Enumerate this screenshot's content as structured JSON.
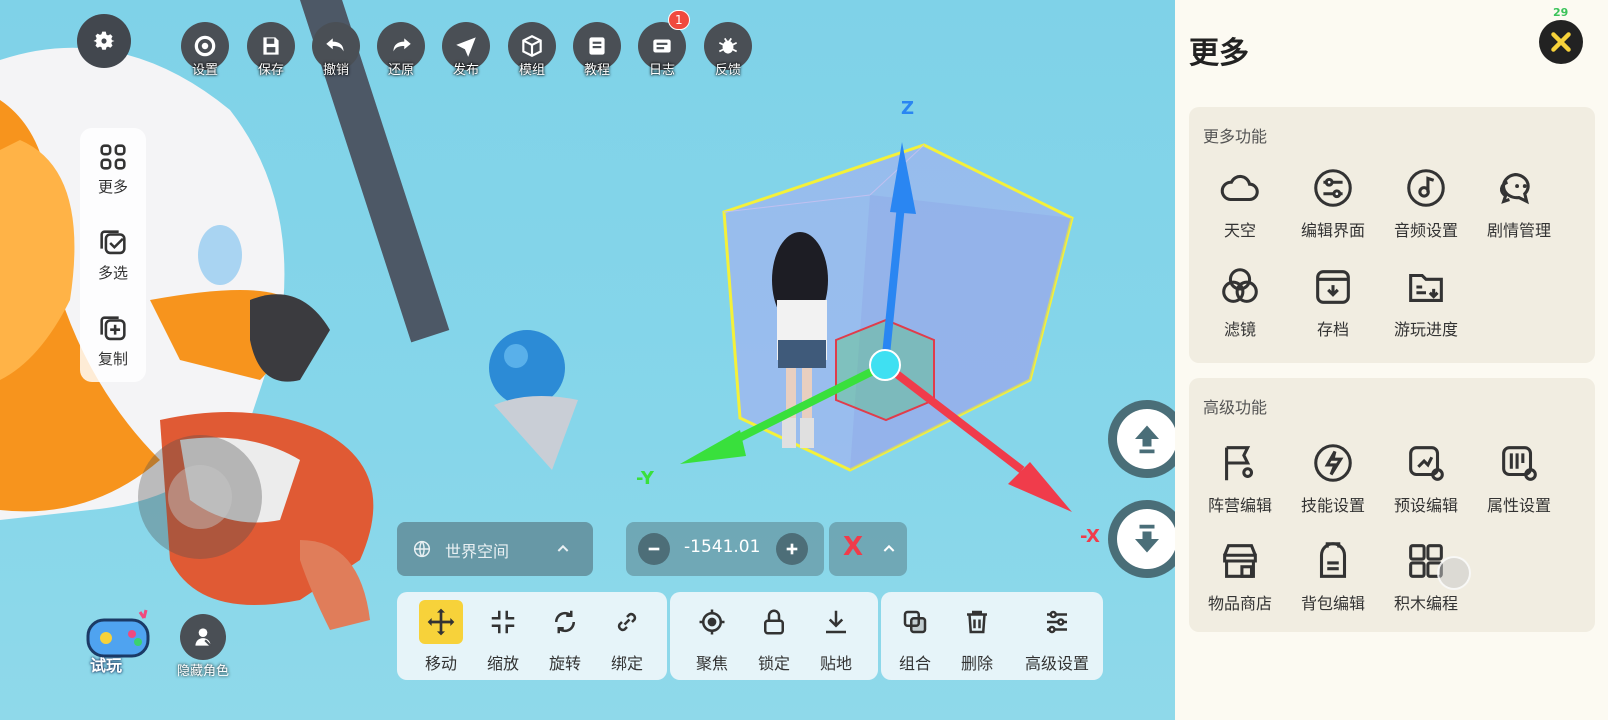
{
  "toolbar": {
    "items": [
      {
        "label": "设置",
        "icon": "gear-icon"
      },
      {
        "label": "保存",
        "icon": "save-icon"
      },
      {
        "label": "撤销",
        "icon": "undo-icon"
      },
      {
        "label": "还原",
        "icon": "redo-icon"
      },
      {
        "label": "发布",
        "icon": "send-icon"
      },
      {
        "label": "模组",
        "icon": "cube-icon"
      },
      {
        "label": "教程",
        "icon": "book-icon"
      },
      {
        "label": "日志",
        "icon": "log-icon"
      },
      {
        "label": "反馈",
        "icon": "bug-icon"
      }
    ],
    "log_badge": "1"
  },
  "left_panel": {
    "items": [
      {
        "label": "更多",
        "icon": "grid-icon"
      },
      {
        "label": "多选",
        "icon": "multi-select-icon"
      },
      {
        "label": "复制",
        "icon": "copy-icon"
      }
    ]
  },
  "viewport": {
    "axis_z": "Z",
    "axis_neg_y": "-Y",
    "axis_neg_x": "-X"
  },
  "space_selector": {
    "label": "世界空间"
  },
  "stepper": {
    "value": "-1541.01"
  },
  "axis_selector": {
    "value": "X"
  },
  "bottom_left": {
    "play_label": "试玩",
    "hide_role_label": "隐藏角色"
  },
  "bottom_toolbar": {
    "group1": [
      {
        "label": "移动",
        "icon": "move-icon"
      },
      {
        "label": "缩放",
        "icon": "scale-icon"
      },
      {
        "label": "旋转",
        "icon": "rotate-icon"
      },
      {
        "label": "绑定",
        "icon": "link-icon"
      }
    ],
    "group2": [
      {
        "label": "聚焦",
        "icon": "focus-icon"
      },
      {
        "label": "锁定",
        "icon": "lock-icon"
      },
      {
        "label": "贴地",
        "icon": "ground-icon"
      }
    ],
    "group3": [
      {
        "label": "组合",
        "icon": "combine-icon"
      },
      {
        "label": "删除",
        "icon": "trash-icon"
      },
      {
        "label": "高级设置",
        "icon": "sliders-icon"
      }
    ]
  },
  "panel": {
    "title": "更多",
    "fps": "29",
    "section1": {
      "title": "更多功能",
      "items": [
        {
          "label": "天空",
          "icon": "cloud-icon"
        },
        {
          "label": "编辑界面",
          "icon": "ui-edit-icon"
        },
        {
          "label": "音频设置",
          "icon": "music-icon"
        },
        {
          "label": "剧情管理",
          "icon": "chat-icon"
        },
        {
          "label": "滤镜",
          "icon": "filter-icon"
        },
        {
          "label": "存档",
          "icon": "archive-icon"
        },
        {
          "label": "游玩进度",
          "icon": "progress-icon"
        }
      ]
    },
    "section2": {
      "title": "高级功能",
      "items": [
        {
          "label": "阵营编辑",
          "icon": "flag-icon"
        },
        {
          "label": "技能设置",
          "icon": "lightning-icon"
        },
        {
          "label": "预设编辑",
          "icon": "preset-icon"
        },
        {
          "label": "属性设置",
          "icon": "attribute-icon"
        },
        {
          "label": "物品商店",
          "icon": "shop-icon"
        },
        {
          "label": "背包编辑",
          "icon": "backpack-icon"
        },
        {
          "label": "积木编程",
          "icon": "blocks-icon"
        }
      ]
    }
  },
  "colors": {
    "sky": "#86d6ea",
    "panel_bg": "#fcfaf2",
    "card_bg": "#f1ede1",
    "move_active": "#f7d23a",
    "axis_x": "#f03c4b",
    "axis_y": "#39e03c",
    "axis_z": "#2a86f2"
  }
}
